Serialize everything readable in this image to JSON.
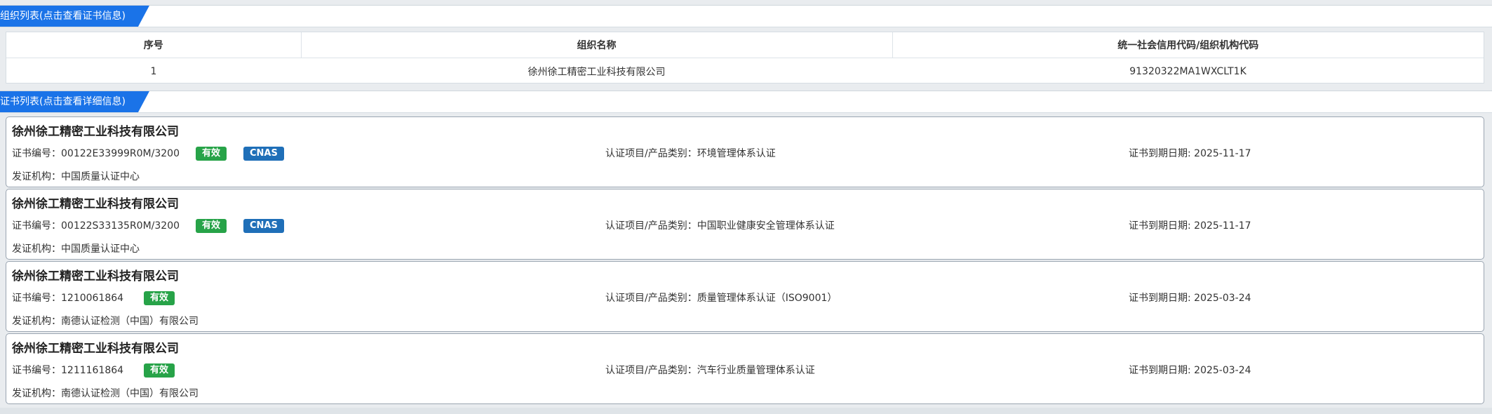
{
  "org_section": {
    "title": "组织列表(点击查看证书信息)",
    "headers": [
      "序号",
      "组织名称",
      "统一社会信用代码/组织机构代码"
    ],
    "rows": [
      [
        "1",
        "徐州徐工精密工业科技有限公司",
        "91320322MA1WXCLT1K"
      ]
    ]
  },
  "cert_section": {
    "title": "证书列表(点击查看详细信息)",
    "certs": [
      {
        "company": "徐州徐工精密工业科技有限公司",
        "cert_no": "证书编号：00122E33999R0M/3200",
        "status": "有效",
        "cnas": "CNAS",
        "project": "认证项目/产品类别：环境管理体系认证",
        "expiry": "证书到期日期: 2025-11-17",
        "issuer": "发证机构：中国质量认证中心"
      },
      {
        "company": "徐州徐工精密工业科技有限公司",
        "cert_no": "证书编号：00122S33135R0M/3200",
        "status": "有效",
        "cnas": "CNAS",
        "project": "认证项目/产品类别：中国职业健康安全管理体系认证",
        "expiry": "证书到期日期: 2025-11-17",
        "issuer": "发证机构：中国质量认证中心"
      },
      {
        "company": "徐州徐工精密工业科技有限公司",
        "cert_no": "证书编号：1210061864",
        "status": "有效",
        "cnas": "",
        "project": "认证项目/产品类别：质量管理体系认证（ISO9001）",
        "expiry": "证书到期日期: 2025-03-24",
        "issuer": "发证机构：南德认证检测（中国）有限公司"
      },
      {
        "company": "徐州徐工精密工业科技有限公司",
        "cert_no": "证书编号：1211161864",
        "status": "有效",
        "cnas": "",
        "project": "认证项目/产品类别：汽车行业质量管理体系认证",
        "expiry": "证书到期日期: 2025-03-24",
        "issuer": "发证机构：南德认证检测（中国）有限公司"
      }
    ]
  },
  "colors": {
    "tab": "#1a73e8",
    "valid_badge": "#27a348",
    "cnas_badge": "#1f6fb8"
  }
}
